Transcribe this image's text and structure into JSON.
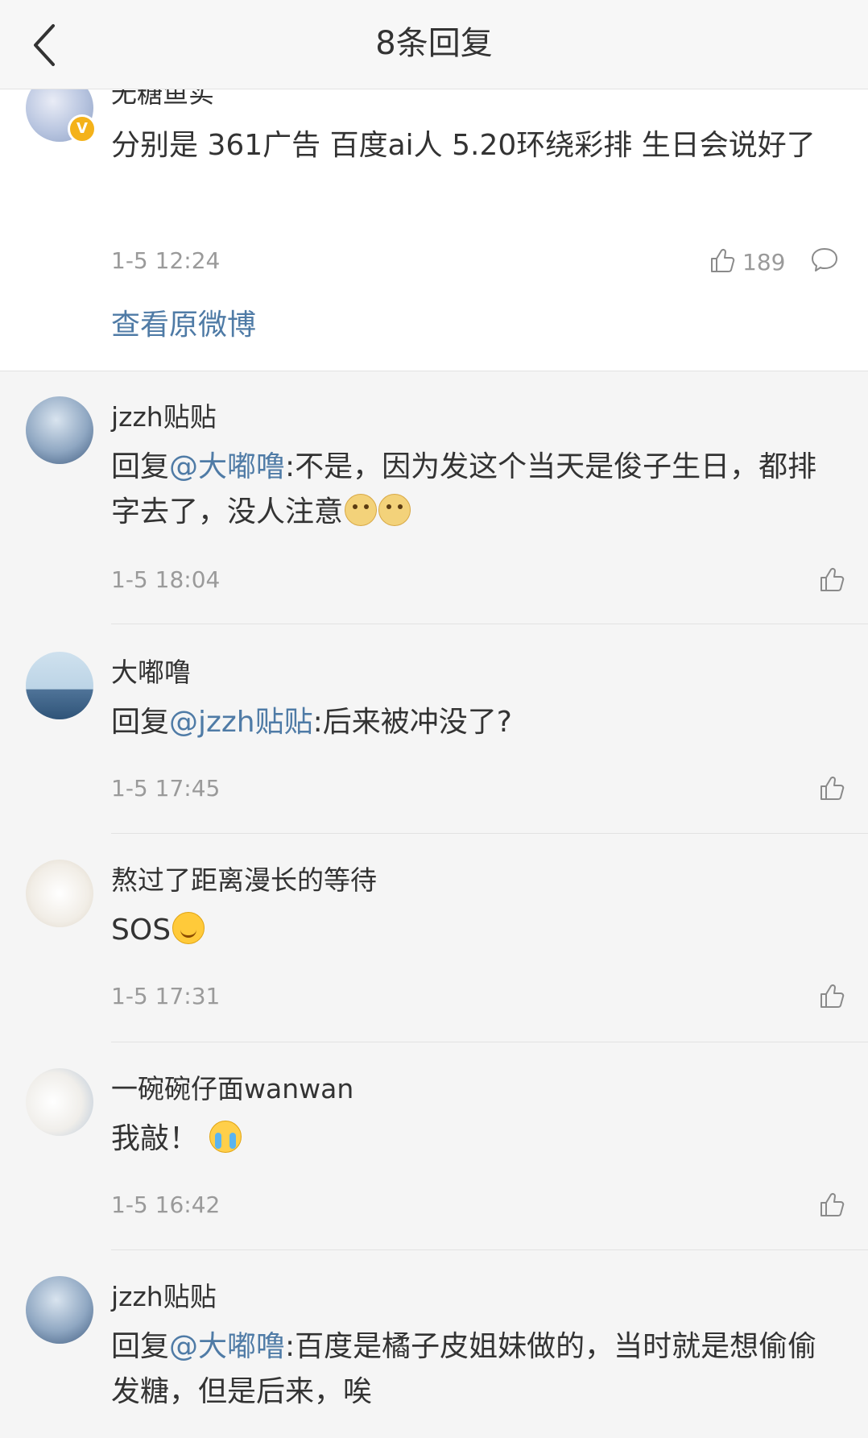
{
  "header": {
    "title": "8条回复"
  },
  "main_post": {
    "username": "无糖鱼实",
    "text": "分别是 361广告 百度ai人 5.20环绕彩排 生日会说好了",
    "time": "1-5 12:24",
    "likes": "189",
    "view_original": "查看原微博"
  },
  "replies": [
    {
      "username": "jzzh贴贴",
      "prefix": "回复",
      "mention": "@大嘟噜",
      "text": ":不是，因为发这个当天是俊子生日，都排字去了，没人注意",
      "emojis": [
        "doge",
        "doge"
      ],
      "time": "1-5 18:04"
    },
    {
      "username": "大嘟噜",
      "prefix": "回复",
      "mention": "@jzzh贴贴",
      "text": ":后来被冲没了?",
      "emojis": [],
      "time": "1-5 17:45"
    },
    {
      "username": "熬过了距离漫长的等待",
      "prefix": "",
      "mention": "",
      "text": "SOS",
      "emojis": [
        "happy"
      ],
      "time": "1-5 17:31"
    },
    {
      "username": "一碗碗仔面wanwan",
      "prefix": "",
      "mention": "",
      "text": "我敲！",
      "emojis": [
        "cry"
      ],
      "time": "1-5 16:42"
    },
    {
      "username": "jzzh贴贴",
      "prefix": "回复",
      "mention": "@大嘟噜",
      "text": ":百度是橘子皮姐妹做的，当时就是想偷偷发糖，但是后来，唉",
      "emojis": [],
      "time": ""
    }
  ],
  "colors": {
    "link": "#4f7ba6",
    "meta": "#9a9a9a",
    "background": "#f5f5f5"
  }
}
